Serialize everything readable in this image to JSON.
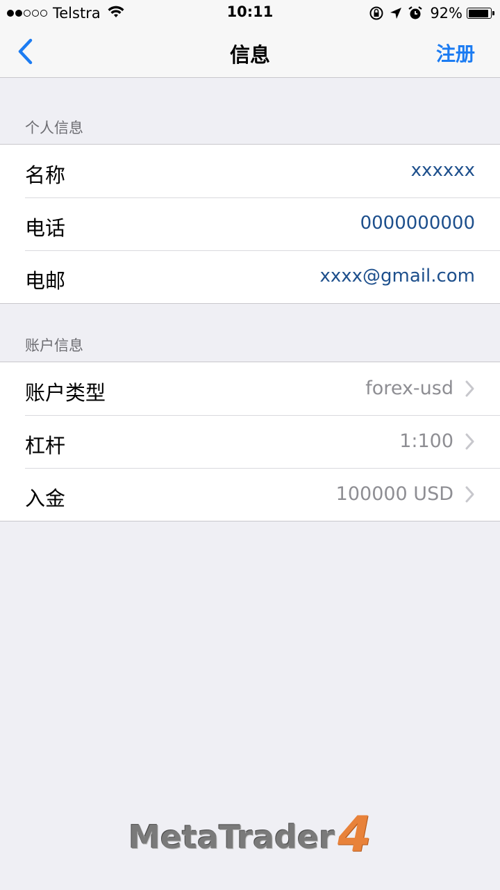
{
  "status_bar": {
    "carrier": "Telstra",
    "time": "10:11",
    "battery_percent": "92%",
    "battery_level": 0.92,
    "signal_bars_filled": 2,
    "signal_bars_total": 5
  },
  "nav": {
    "title": "信息",
    "action_label": "注册",
    "back_icon": "chevron-left-icon",
    "accent_color": "#1c7cf2"
  },
  "personal": {
    "header": "个人信息",
    "rows": [
      {
        "label": "名称",
        "value": "xxxxxx"
      },
      {
        "label": "电话",
        "value": "0000000000"
      },
      {
        "label": "电邮",
        "value": "xxxx@gmail.com"
      }
    ]
  },
  "account": {
    "header": "账户信息",
    "rows": [
      {
        "label": "账户类型",
        "value": "forex-usd"
      },
      {
        "label": "杠杆",
        "value": "1:100"
      },
      {
        "label": "入金",
        "value": "100000 USD"
      }
    ]
  },
  "logo": {
    "text": "MetaTrader",
    "number": "4"
  }
}
